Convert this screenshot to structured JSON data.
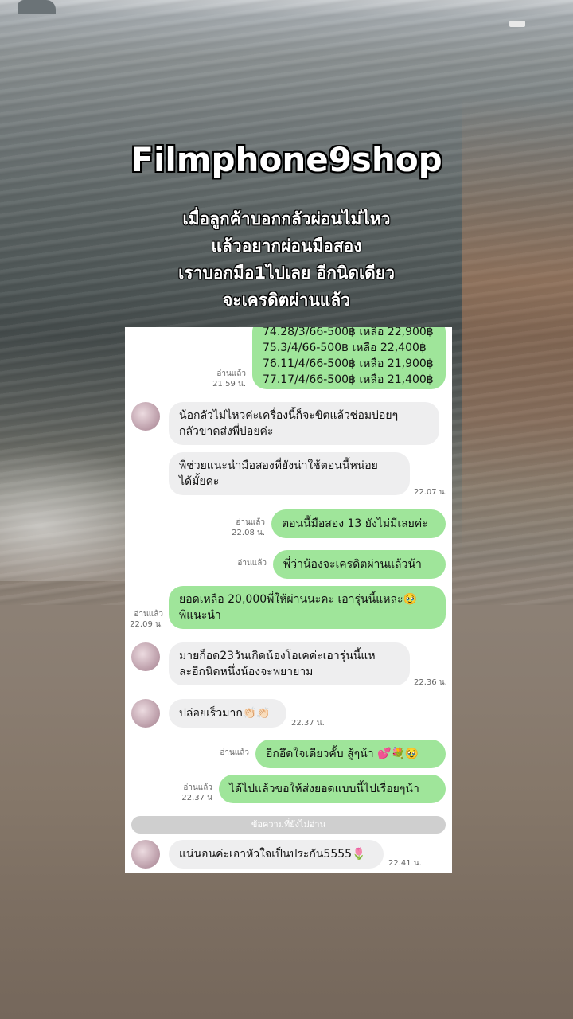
{
  "overlay": {
    "title": "Filmphone9shop",
    "subtitle_lines": [
      "เมื่อลูกค้าบอกกลัวผ่อนไม่ไหว",
      "แล้วอยากผ่อนมือสอง",
      "เราบอกมือ1ไปเลย อีกนิดเดียว",
      "จะเครดิตผ่านแล้ว"
    ]
  },
  "chat": {
    "m1": {
      "lines": [
        "74.28/3/66-500฿ เหลือ 22,900฿",
        "75.3/4/66-500฿ เหลือ 22,400฿",
        "76.11/4/66-500฿ เหลือ 21,900฿",
        "77.17/4/66-500฿ เหลือ 21,400฿"
      ],
      "read": "อ่านแล้ว",
      "time": "21.59 น."
    },
    "m2": {
      "lines": [
        "น้อกลัวไม่ไหวค่ะเครื่องนี้ก็จะขิตแล้วซ่อมบ่อยๆ",
        "กลัวขาดส่งพี่บ่อยค่ะ"
      ]
    },
    "m3": {
      "lines": [
        "พี่ช่วยแนะนำมือสองที่ยังน่าใช้ตอนนี้หน่อย",
        "ได้มั้ยคะ"
      ],
      "time": "22.07 น."
    },
    "m4": {
      "text": "ตอนนี้มือสอง 13 ยังไม่มีเลยค่ะ",
      "read": "อ่านแล้ว",
      "time": "22.08 น."
    },
    "m5": {
      "text": "พี่ว่าน้องจะเครดิตผ่านแล้วน้า",
      "read": "อ่านแล้ว"
    },
    "m6": {
      "lines": [
        "ยอดเหลือ 20,000พี่ให้ผ่านนะคะ เอารุ่นนี้แหละ🥹",
        "พี่แนะนำ"
      ],
      "read": "อ่านแล้ว",
      "time": "22.09 น."
    },
    "m7": {
      "lines": [
        "มายก็อด23วันเกิดน้องโอเคค่ะเอารุ่นนี้แห",
        "ละอีกนิดหนึ่งน้องจะพยายาม"
      ],
      "time": "22.36 น."
    },
    "m8": {
      "text": "ปล่อยเร็วมาก👏🏻👏🏻",
      "time": "22.37 น."
    },
    "m9": {
      "text": "อีกอึดใจเดียวคั้บ สู้ๆน้า 💕💐🥹",
      "read": "อ่านแล้ว"
    },
    "m10": {
      "text": "ได้ไปแล้วขอให้ส่งยอดแบบนี้ไปเรื่อยๆน้า",
      "read": "อ่านแล้ว",
      "time": "22.37 น"
    },
    "unread_label": "ข้อความที่ยังไม่อ่าน",
    "m11": {
      "text": "แน่นอนค่ะเอาหัวใจเป็นประกัน5555🌷",
      "time": "22.41 น."
    }
  }
}
